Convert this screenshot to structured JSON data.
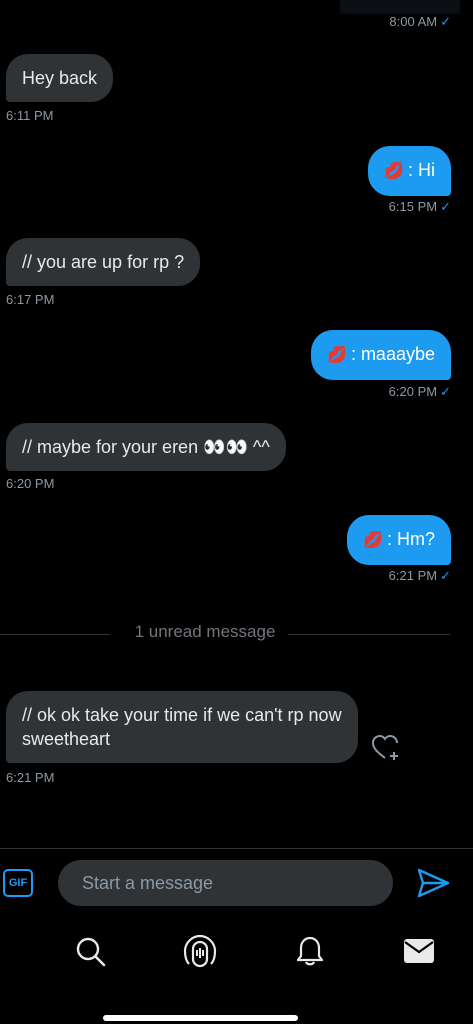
{
  "header": {
    "first_time": "8:00 AM"
  },
  "messages": [
    {
      "dir": "in",
      "text": "Hey back",
      "time": "6:11 PM"
    },
    {
      "dir": "out",
      "emoji": "💋",
      "text": ": Hi",
      "time": "6:15 PM"
    },
    {
      "dir": "in",
      "text": "// you are up for rp ?",
      "time": "6:17 PM"
    },
    {
      "dir": "out",
      "emoji": "💋",
      "text": ": maaaybe",
      "time": "6:20 PM"
    },
    {
      "dir": "in",
      "text": "// maybe for your eren 👀👀 ^^",
      "time": "6:20 PM"
    },
    {
      "dir": "out",
      "emoji": "💋",
      "text": ": Hm?",
      "time": "6:21 PM"
    },
    {
      "dir": "in",
      "text": "// ok ok take your time if we can't rp now sweetheart",
      "time": "6:21 PM"
    }
  ],
  "read_check": "✓",
  "divider": {
    "text": "1 unread message"
  },
  "composer": {
    "gif_label": "GIF",
    "placeholder": "Start a message"
  },
  "nav": [
    "search-icon",
    "spaces-icon",
    "notifications-icon",
    "messages-icon"
  ],
  "colors": {
    "accent": "#1d9bf0",
    "incoming_bubble": "#2f3336",
    "background": "#000000"
  }
}
